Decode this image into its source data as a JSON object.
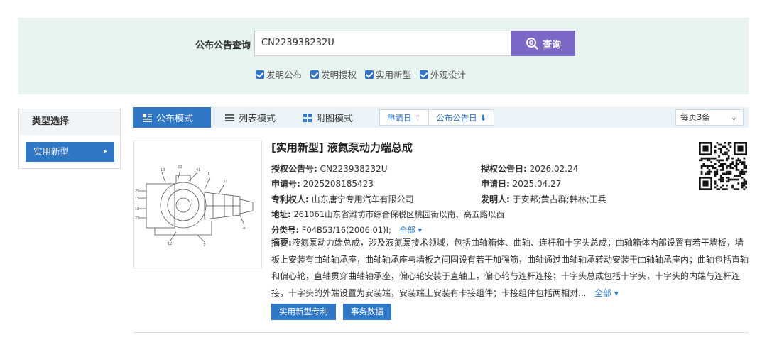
{
  "search": {
    "label": "公布公告查询",
    "value": "CN223938232U",
    "button_label": "查询",
    "filters": [
      {
        "label": "发明公布",
        "checked": true
      },
      {
        "label": "发明授权",
        "checked": true
      },
      {
        "label": "实用新型",
        "checked": true
      },
      {
        "label": "外观设计",
        "checked": true
      }
    ]
  },
  "sidebar": {
    "title": "类型选择",
    "items": [
      {
        "label": "实用新型"
      }
    ]
  },
  "toolbar": {
    "modes": [
      {
        "label": "公布模式",
        "active": true
      },
      {
        "label": "列表模式",
        "active": false
      },
      {
        "label": "附图模式",
        "active": false
      }
    ],
    "sort": [
      {
        "label": "申请日",
        "arrow": "↑"
      },
      {
        "label": "公布公告日",
        "arrow": "⬇"
      }
    ],
    "per_page": "每页3条"
  },
  "result": {
    "title": "[实用新型] 液氮泵动力端总成",
    "grant_no_label": "授权公告号:",
    "grant_no": "CN223938232U",
    "grant_date_label": "授权公告日:",
    "grant_date": "2026.02.24",
    "app_no_label": "申请号:",
    "app_no": "2025208185423",
    "app_date_label": "申请日:",
    "app_date": "2025.04.27",
    "patentee_label": "专利权人:",
    "patentee": "山东唐宁专用汽车有限公司",
    "inventor_label": "发明人:",
    "inventor": "于安邦;黄占群;韩林;王兵",
    "address_label": "地址:",
    "address": "261061山东省潍坊市综合保税区桃园街以南、高五路以西",
    "class_label": "分类号:",
    "class_no": "F04B53/16(2006.01)I;",
    "more_label": "全部",
    "abstract_label": "摘要:",
    "abstract": "液氮泵动力端总成，涉及液氮泵技术领域，包括曲轴箱体、曲轴、连杆和十字头总成；曲轴箱体内部设置有若干墙板，墙板上安装有曲轴轴承座，曲轴轴承座与墙板之间固设有若干加强筋，曲轴通过曲轴轴承转动安装于曲轴轴承座内；曲轴包括直轴和偏心轮，直轴贯穿曲轴轴承座，偏心轮安装于直轴上，偏心轮与连杆连接；十字头总成包括十字头，十字头的内端与连杆连接，十字头的外端设置为安装端，安装端上安装有卡接组件；卡接组件包括两相对...",
    "abstract_more": "全部",
    "buttons": [
      "实用新型专利",
      "事务数据"
    ]
  },
  "colors": {
    "accent": "#2e78c7",
    "search_button": "#7b68c6",
    "panel_bg": "#e8f4f1"
  }
}
